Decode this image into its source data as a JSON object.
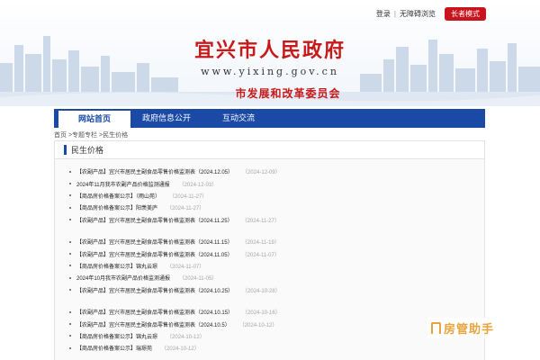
{
  "topbar": {
    "login": "登录",
    "accessible": "无障碍浏览",
    "elder_mode": "长者模式"
  },
  "header": {
    "title": "宜兴市人民政府",
    "url": "www.yixing.gov.cn",
    "department": "市发展和改革委员会"
  },
  "nav": {
    "items": [
      {
        "label": "网站首页"
      },
      {
        "label": "政府信息公开"
      },
      {
        "label": "互动交流"
      }
    ]
  },
  "breadcrumb": {
    "home": "首页",
    "sep1": " >",
    "column": "专题专栏",
    "sep2": " >",
    "current": "民生价格"
  },
  "panel": {
    "title": "民生价格"
  },
  "list": {
    "groups": [
      [
        {
          "title": "【农副产品】宜兴市居民主副食品零售价格监测表（2024.12.05）",
          "date": "（2024-12-09）"
        },
        {
          "title": "2024年11月我市农副产品价格监测通报",
          "date": "（2024-12-03）"
        },
        {
          "title": "【商品房价格备案公示】（雨山苑）",
          "date": "（2024-11-27）"
        },
        {
          "title": "【商品房价格备案公示】阳羡美庐",
          "date": "（2024-11-27）"
        },
        {
          "title": "【农副产品】宜兴市居民主副食品零售价格监测表（2024.11.25）",
          "date": "（2024-11-27）"
        }
      ],
      [
        {
          "title": "【农副产品】宜兴市居民主副食品零售价格监测表（2024.11.15）",
          "date": "（2024-11-19）"
        },
        {
          "title": "【农副产品】宜兴市居民主副食品零售价格监测表（2024.11.05）",
          "date": "（2024-11-07）"
        },
        {
          "title": "【商品房价格备案公示】锦丸云璟",
          "date": "（2024-11-07）"
        },
        {
          "title": "2024年10月我市农副产品价格监测通报",
          "date": "（2024-11-05）"
        },
        {
          "title": "【农副产品】宜兴市居民主副食品零售价格监测表（2024.10.25）",
          "date": "（2024-10-28）"
        }
      ],
      [
        {
          "title": "【农副产品】宜兴市居民主副食品零售价格监测表（2024.10.15）",
          "date": "（2024-10-16）"
        },
        {
          "title": "【农副产品】宜兴市居民主副食品零售价格监测表（2024.10.5）",
          "date": "（2024-10-12）"
        },
        {
          "title": "【商品房价格备案公示】锦丸云璟",
          "date": "（2024-10-12）"
        },
        {
          "title": "【商品房价格备案公示】瑞璟苑",
          "date": "（2024-10-12）"
        }
      ]
    ]
  },
  "watermark": {
    "text": "房管助手",
    "icon": "house-icon"
  },
  "colors": {
    "brand_red": "#c61a1a",
    "nav_blue": "#1a4aa6",
    "elder_button": "#c9141e",
    "date_gray": "#a5a5a5",
    "watermark_orange": "#e8a33d"
  }
}
